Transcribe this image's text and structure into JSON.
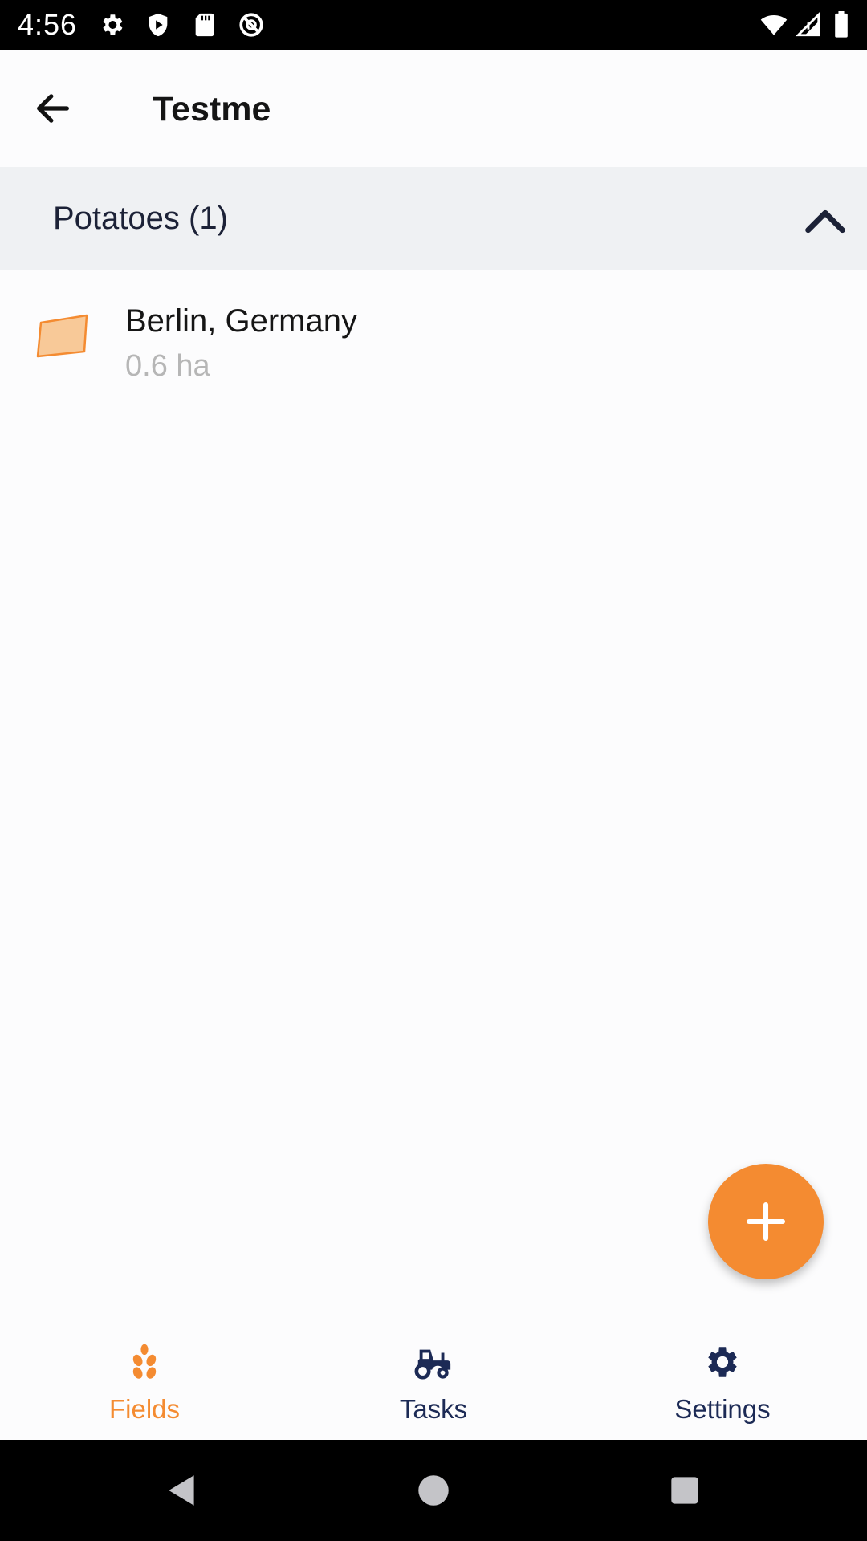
{
  "status_bar": {
    "time": "4:56",
    "left_icons": [
      "settings-icon",
      "shield-play-icon",
      "sd-card-icon",
      "at-sign-icon"
    ],
    "right_icons": [
      "wifi-icon",
      "signal-icon",
      "battery-icon"
    ]
  },
  "app_bar": {
    "back_icon": "arrow-left-icon",
    "title": "Testme"
  },
  "group": {
    "title": "Potatoes (1)",
    "expanded": true,
    "chevron_icon": "chevron-up-icon"
  },
  "fields": [
    {
      "name": "Berlin, Germany",
      "area": "0.6 ha",
      "shape_icon": "field-polygon-icon",
      "color": "#f48b31"
    }
  ],
  "fab": {
    "icon": "plus-icon",
    "color": "#f48b31"
  },
  "bottom_nav": {
    "items": [
      {
        "label": "Fields",
        "icon": "wheat-icon",
        "active": true
      },
      {
        "label": "Tasks",
        "icon": "tractor-icon",
        "active": false
      },
      {
        "label": "Settings",
        "icon": "gear-icon",
        "active": false
      }
    ],
    "active_color": "#f48b31",
    "inactive_color": "#1c2a55"
  },
  "system_nav": {
    "buttons": [
      "back-triangle-icon",
      "home-circle-icon",
      "recents-square-icon"
    ]
  }
}
